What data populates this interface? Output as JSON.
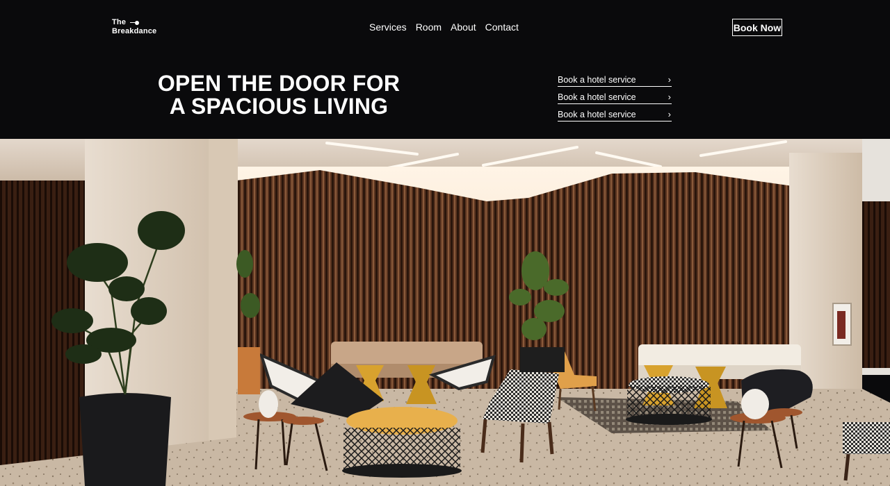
{
  "brand": {
    "line1": "The",
    "line2": "Breakdance"
  },
  "nav": {
    "items": [
      "Services",
      "Room",
      "About",
      "Contact"
    ]
  },
  "cta": {
    "label": "Book Now"
  },
  "hero": {
    "title": "OPEN THE DOOR FOR A SPACIOUS LIVING"
  },
  "services": {
    "items": [
      "Book a hotel service",
      "Book a hotel service",
      "Book a hotel service"
    ]
  },
  "icons": {
    "service_chevron": "chevron-right-icon",
    "logo_mark": "key-icon"
  },
  "colors": {
    "background": "#0a0a0c",
    "text": "#ffffff",
    "accent": "#d9a441"
  }
}
